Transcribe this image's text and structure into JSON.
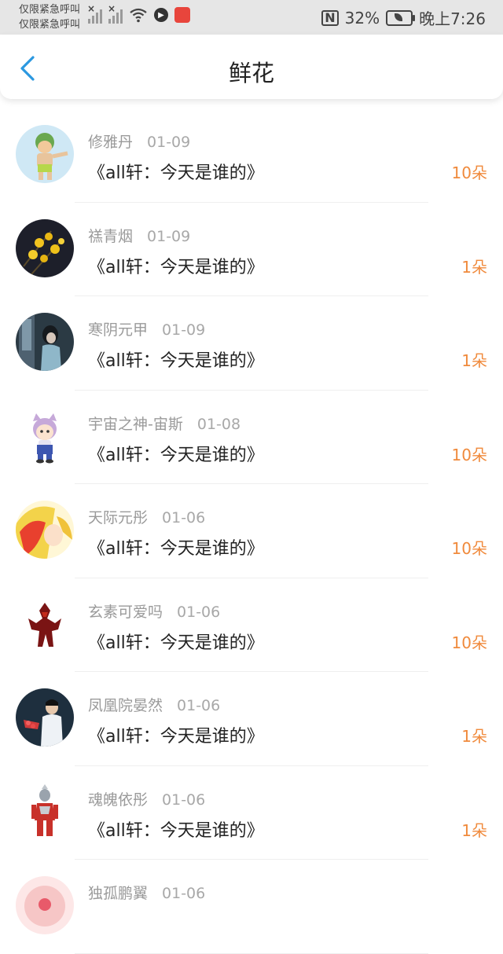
{
  "status_bar": {
    "carrier_line1": "仅限紧急呼叫",
    "carrier_line2": "仅限紧急呼叫",
    "nfc": "N",
    "battery": "32%",
    "time": "晚上7:26"
  },
  "header": {
    "title": "鲜花"
  },
  "items": [
    {
      "name": "修雅丹",
      "date": "01-09",
      "book": "《all轩：今天是谁的》",
      "count": "10朵"
    },
    {
      "name": "禚青烟",
      "date": "01-09",
      "book": "《all轩：今天是谁的》",
      "count": "1朵"
    },
    {
      "name": "寒阴元甲",
      "date": "01-09",
      "book": "《all轩：今天是谁的》",
      "count": "1朵"
    },
    {
      "name": "宇宙之神-宙斯",
      "date": "01-08",
      "book": "《all轩：今天是谁的》",
      "count": "10朵"
    },
    {
      "name": "天际元彤",
      "date": "01-06",
      "book": "《all轩：今天是谁的》",
      "count": "10朵"
    },
    {
      "name": "玄素可爱吗",
      "date": "01-06",
      "book": "《all轩：今天是谁的》",
      "count": "10朵"
    },
    {
      "name": "凤凰院晏然",
      "date": "01-06",
      "book": "《all轩：今天是谁的》",
      "count": "1朵"
    },
    {
      "name": "魂魄依彤",
      "date": "01-06",
      "book": "《all轩：今天是谁的》",
      "count": "1朵"
    },
    {
      "name": "独孤鹏翼",
      "date": "01-06",
      "book": "",
      "count": ""
    }
  ]
}
